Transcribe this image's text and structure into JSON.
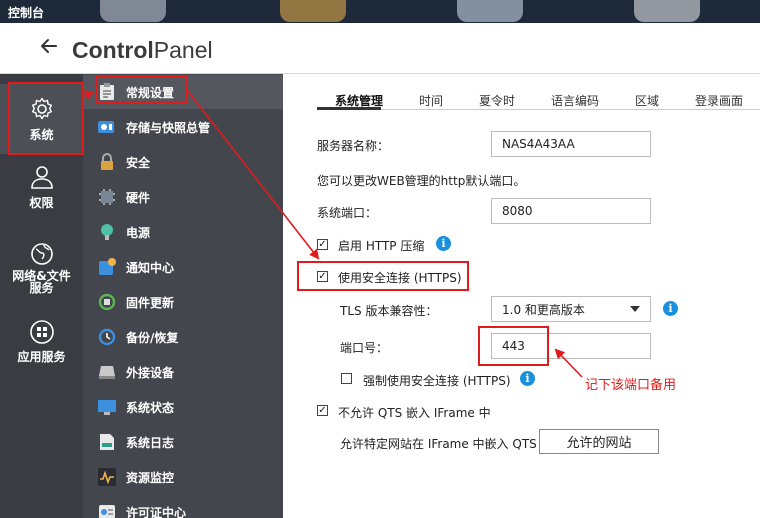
{
  "window": {
    "title": "控制台"
  },
  "header": {
    "back_icon": "arrow-left-icon",
    "brand_bold": "Control",
    "brand_rest": "Panel"
  },
  "rail": {
    "items": [
      {
        "label": "系统",
        "icon": "gear-icon"
      },
      {
        "label": "权限",
        "icon": "user-icon"
      },
      {
        "label": "网络&文件\n服务",
        "icon": "globe-icon"
      },
      {
        "label": "应用服务",
        "icon": "apps-icon"
      }
    ]
  },
  "submenu": {
    "items": [
      {
        "label": "常规设置"
      },
      {
        "label": "存储与快照总管"
      },
      {
        "label": "安全"
      },
      {
        "label": "硬件"
      },
      {
        "label": "电源"
      },
      {
        "label": "通知中心"
      },
      {
        "label": "固件更新"
      },
      {
        "label": "备份/恢复"
      },
      {
        "label": "外接设备"
      },
      {
        "label": "系统状态"
      },
      {
        "label": "系统日志"
      },
      {
        "label": "资源监控"
      },
      {
        "label": "许可证中心"
      }
    ]
  },
  "tabs": [
    {
      "label": "系统管理"
    },
    {
      "label": "时间"
    },
    {
      "label": "夏令时"
    },
    {
      "label": "语言编码"
    },
    {
      "label": "区域"
    },
    {
      "label": "登录画面"
    }
  ],
  "form": {
    "server_name_label": "服务器名称：",
    "server_name_value": "NAS4A43AA",
    "http_hint": "您可以更改WEB管理的http默认端口。",
    "system_port_label": "系统端口：",
    "system_port_value": "8080",
    "enable_http_compress": "启用 HTTP 压缩",
    "use_https": "使用安全连接 (HTTPS)",
    "tls_label": "TLS 版本兼容性：",
    "tls_value": "1.0 和更高版本",
    "https_port_label": "端口号：",
    "https_port_value": "443",
    "force_https": "强制使用安全连接 (HTTPS)",
    "no_iframe": "不允许 QTS 嵌入 IFrame 中",
    "allow_iframe_label": "允许特定网站在 IFrame 中嵌入 QTS",
    "allowed_sites_button": "允许的网站",
    "info_glyph": "i",
    "check_glyph": "✓"
  },
  "annotation": {
    "note": "记下该端口备用"
  },
  "colors": {
    "annotation_red": "#e01b1b",
    "info_blue": "#1a8fdc"
  }
}
